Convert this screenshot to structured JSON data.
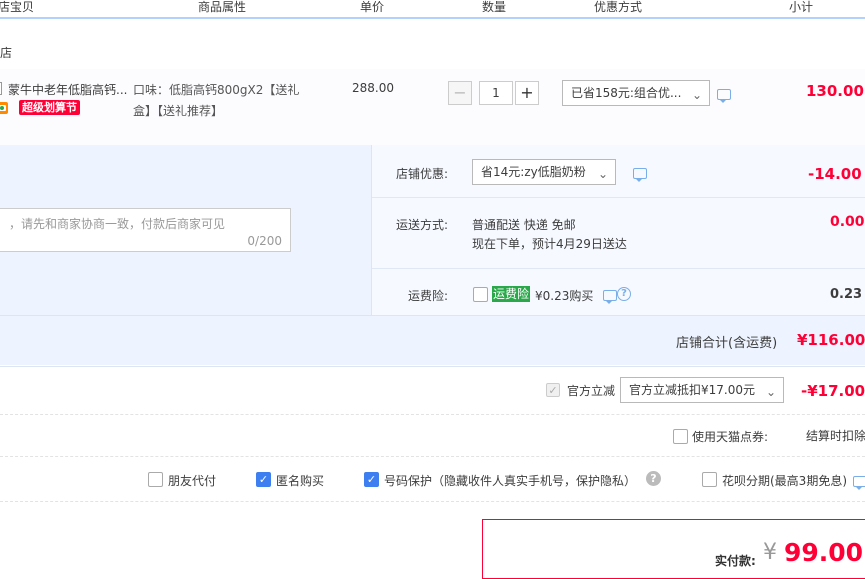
{
  "header": {
    "col_item": "店宝贝",
    "col_attr": "商品属性",
    "col_price": "单价",
    "col_qty": "数量",
    "col_discount": "优惠方式",
    "col_subtotal": "小计"
  },
  "shop": {
    "name_partial": "店"
  },
  "item": {
    "title": "蒙牛中老年低脂高钙...",
    "badge": "超级划算节",
    "attr_line1": "口味：低脂高钙800gX2【送礼",
    "attr_line2": "盒】【送礼推荐】",
    "price": "288.00",
    "qty": "1",
    "qty_minus": "−",
    "qty_plus": "+",
    "discount_select": "已省158元:组合优...",
    "subtotal": "130.00"
  },
  "message": {
    "placeholder": "，请先和商家协商一致，付款后商家可见",
    "counter": "0/200"
  },
  "shop_discount": {
    "label": "店铺优惠:",
    "select": "省14元:zy低脂奶粉",
    "amount": "-14.00"
  },
  "delivery": {
    "label": "运送方式:",
    "line1": "普通配送 快递 免邮",
    "line2": "现在下单，预计4月29日送达",
    "amount": "0.00"
  },
  "insurance": {
    "label": "运费险:",
    "tag": "运费险",
    "price_text": "¥0.23购买",
    "amount": "0.23"
  },
  "shop_total": {
    "label": "店铺合计(含运费)",
    "amount": "¥116.00"
  },
  "official_discount": {
    "label": "官方立减",
    "select": "官方立减抵扣¥17.00元",
    "amount": "-¥17.00"
  },
  "tmall_points": {
    "label": "使用天猫点券:",
    "note": "结算时扣除"
  },
  "options": {
    "friend_pay": "朋友代付",
    "anonymous": "匿名购买",
    "number_protect": "号码保护（隐藏收件人真实手机号，保护隐私）",
    "huabei": "花呗分期(最高3期免息)"
  },
  "payment": {
    "label": "实付款:",
    "currency": "¥",
    "amount": "99.00"
  },
  "colors": {
    "accent_red": "#ff0036",
    "accent_blue": "#3d7ff1",
    "header_line": "#b2d1ff",
    "insurance_green": "#2aa84a"
  }
}
